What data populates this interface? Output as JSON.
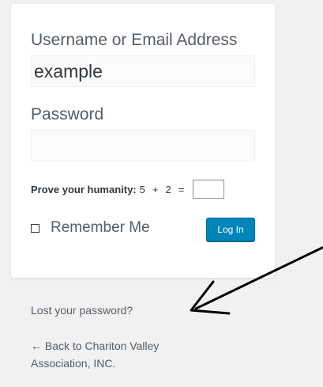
{
  "login_form": {
    "username_label": "Username or Email Address",
    "username_value": "example",
    "password_label": "Password",
    "password_value": "",
    "captcha": {
      "label": "Prove your humanity:",
      "operand_a": "5",
      "operator": "+",
      "operand_b": "2",
      "equals": "=",
      "answer_value": ""
    },
    "remember_me_label": "Remember Me",
    "remember_me_checked": false,
    "login_button_label": "Log In"
  },
  "links": {
    "lost_password": "Lost your password?",
    "back_to_site": "← Back to Chariton Valley Association, INC."
  },
  "colors": {
    "background": "#f1f1f1",
    "card": "#ffffff",
    "button": "#0085ba",
    "text": "#555d66",
    "annotation_arrow": "#000000"
  },
  "icons": {
    "annotation": "hand-drawn-arrow-icon"
  }
}
